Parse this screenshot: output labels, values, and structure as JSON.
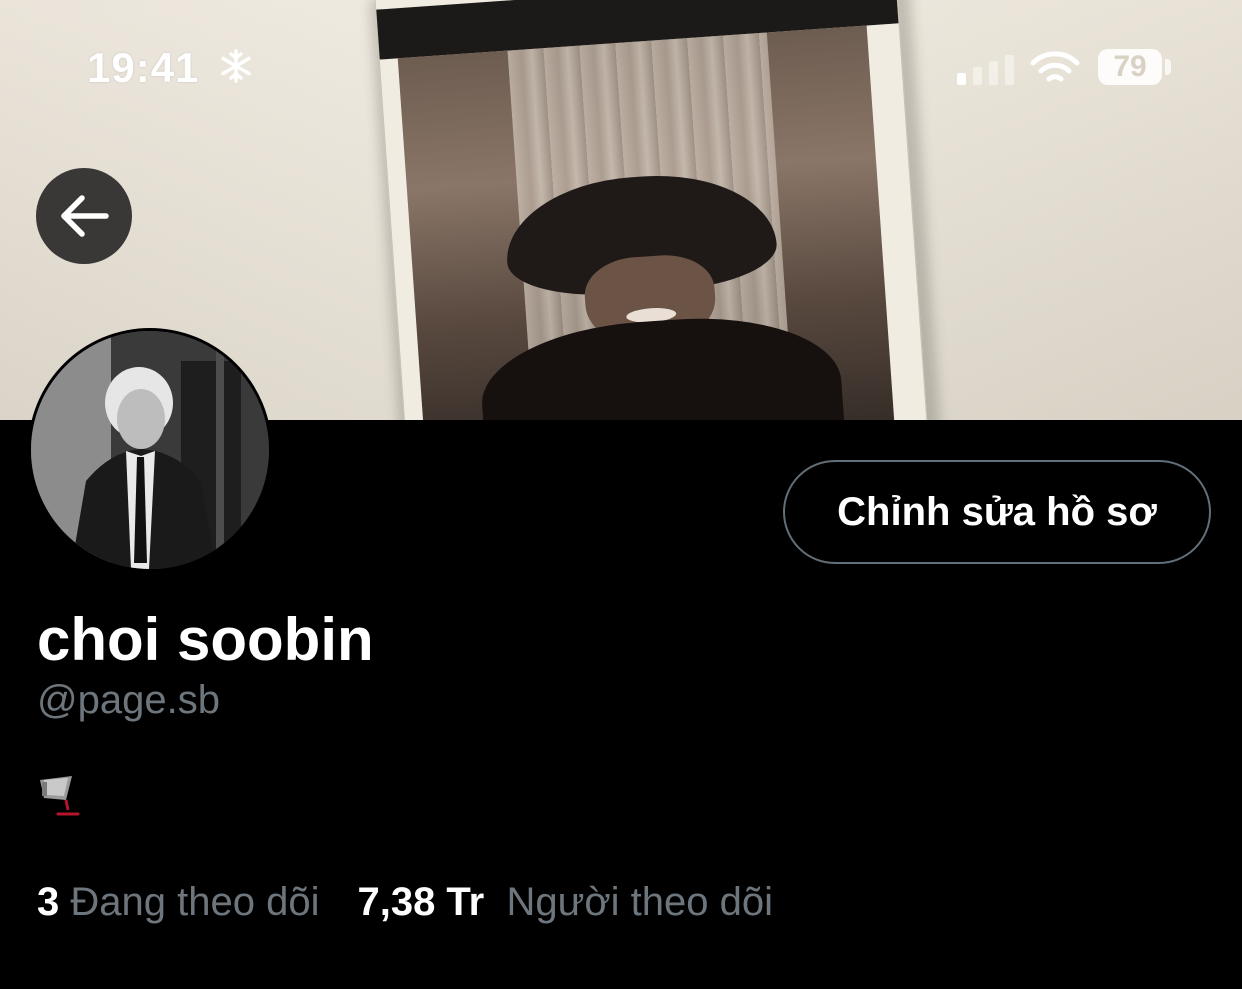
{
  "status_bar": {
    "time": "19:41",
    "battery": "79",
    "icons": [
      "snowflake-icon",
      "cellular-signal-icon",
      "wifi-icon",
      "battery-icon"
    ]
  },
  "navigation": {
    "back_icon": "arrow-left-icon"
  },
  "profile": {
    "display_name": "choi soobin",
    "handle": "@page.sb",
    "bio_emoji": "megaphone-icon",
    "edit_button_label": "Chỉnh sửa hồ sơ"
  },
  "stats": {
    "following_count": "3",
    "following_label": "Đang theo dõi",
    "followers_count": "7,38 Tr",
    "followers_label": "Người theo dõi"
  },
  "colors": {
    "background": "#000000",
    "muted_text": "#6e767d",
    "button_border": "#626e78"
  }
}
